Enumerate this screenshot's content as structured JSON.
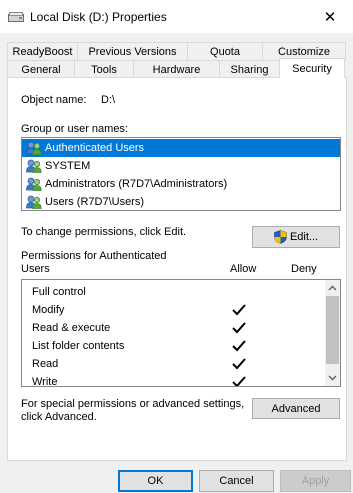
{
  "window": {
    "title": "Local Disk (D:) Properties",
    "close_glyph": "✕"
  },
  "tabs": {
    "back_row": [
      "ReadyBoost",
      "Previous Versions",
      "Quota",
      "Customize"
    ],
    "front_row": [
      "General",
      "Tools",
      "Hardware",
      "Sharing",
      "Security"
    ],
    "active": "Security"
  },
  "security": {
    "object_name_label": "Object name:",
    "object_name_value": "D:\\",
    "group_label": "Group or user names:",
    "groups": [
      {
        "name": "Authenticated Users",
        "selected": true
      },
      {
        "name": "SYSTEM",
        "selected": false
      },
      {
        "name": "Administrators (R7D7\\Administrators)",
        "selected": false
      },
      {
        "name": "Users (R7D7\\Users)",
        "selected": false
      }
    ],
    "change_text": "To change permissions, click Edit.",
    "edit_button": "Edit...",
    "permissions_label_line1": "Permissions for Authenticated",
    "permissions_label_line2": "Users",
    "allow_header": "Allow",
    "deny_header": "Deny",
    "permissions": [
      {
        "name": "Full control",
        "allow": false,
        "deny": false
      },
      {
        "name": "Modify",
        "allow": true,
        "deny": false
      },
      {
        "name": "Read & execute",
        "allow": true,
        "deny": false
      },
      {
        "name": "List folder contents",
        "allow": true,
        "deny": false
      },
      {
        "name": "Read",
        "allow": true,
        "deny": false
      },
      {
        "name": "Write",
        "allow": true,
        "deny": false
      }
    ],
    "special_text_line1": "For special permissions or advanced settings,",
    "special_text_line2": "click Advanced.",
    "advanced_button": "Advanced"
  },
  "footer": {
    "ok": "OK",
    "cancel": "Cancel",
    "apply": "Apply"
  },
  "colors": {
    "selection": "#0078d7",
    "shield_blue": "#1f5fbf",
    "shield_yellow": "#f2c200"
  },
  "icons": {
    "title": "drive-icon",
    "group": "users-icon",
    "edit": "uac-shield-icon",
    "check": "checkmark-icon"
  }
}
